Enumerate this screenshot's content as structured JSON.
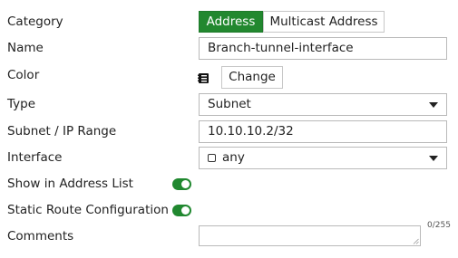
{
  "form": {
    "category": {
      "label": "Category",
      "options": [
        "Address",
        "Multicast Address"
      ],
      "selected": "Address"
    },
    "name": {
      "label": "Name",
      "value": "Branch-tunnel-interface"
    },
    "color": {
      "label": "Color",
      "icon": "color-swatch-icon",
      "button_label": "Change"
    },
    "type": {
      "label": "Type",
      "value": "Subnet"
    },
    "subnet": {
      "label": "Subnet / IP Range",
      "value": "10.10.10.2/32"
    },
    "interface": {
      "label": "Interface",
      "value": "any",
      "icon": "interface-icon"
    },
    "show_in_list": {
      "label": "Show in Address List",
      "enabled": true
    },
    "static_route": {
      "label": "Static Route Configuration",
      "enabled": true
    },
    "comments": {
      "label": "Comments",
      "value": "",
      "counter": "0/255"
    }
  },
  "colors": {
    "accent": "#22882f",
    "border": "#b9b9b9",
    "text": "#222222"
  }
}
